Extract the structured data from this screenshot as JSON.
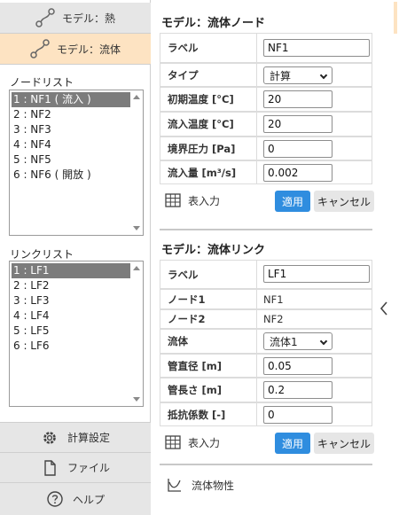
{
  "modes": {
    "heat": "モデル：熱",
    "fluid": "モデル：流体"
  },
  "node_list": {
    "title": "ノードリスト",
    "items": [
      "1 : NF1 ( 流入 )",
      "2 : NF2",
      "3 : NF3",
      "4 : NF4",
      "5 : NF5",
      "6 : NF6 ( 開放 )"
    ],
    "selected_index": 0
  },
  "link_list": {
    "title": "リンクリスト",
    "items": [
      "1 : LF1",
      "2 : LF2",
      "3 : LF3",
      "4 : LF4",
      "5 : LF5",
      "6 : LF6"
    ],
    "selected_index": 0
  },
  "bottom_nav": {
    "settings": "計算設定",
    "file": "ファイル",
    "help": "ヘルプ"
  },
  "node_panel": {
    "title": "モデル：流体ノード",
    "label_label": "ラベル",
    "label_value": "NF1",
    "type_label": "タイプ",
    "type_value": "計算",
    "init_temp_label": "初期温度 [°C]",
    "init_temp_value": "20",
    "inflow_temp_label": "流入温度 [°C]",
    "inflow_temp_value": "20",
    "boundary_pressure_label": "境界圧力 [Pa]",
    "boundary_pressure_value": "0",
    "inflow_rate_label": "流入量 [m³/s]",
    "inflow_rate_value": "0.002",
    "table_input": "表入力",
    "apply": "適用",
    "cancel": "キャンセル"
  },
  "link_panel": {
    "title": "モデル：流体リンク",
    "label_label": "ラベル",
    "label_value": "LF1",
    "node1_label": "ノード1",
    "node1_value": "NF1",
    "node2_label": "ノード2",
    "node2_value": "NF2",
    "fluid_label": "流体",
    "fluid_value": "流体1",
    "diameter_label": "管直径 [m]",
    "diameter_value": "0.05",
    "length_label": "管長さ [m]",
    "length_value": "0.2",
    "resistance_label": "抵抗係数 [-]",
    "resistance_value": "0",
    "table_input": "表入力",
    "apply": "適用",
    "cancel": "キャンセル"
  },
  "fluid_properties": "流体物性",
  "colors": {
    "accent": "#2f8ddf",
    "active_mode": "#fde3c2",
    "selected_item": "#7c7c7c"
  }
}
